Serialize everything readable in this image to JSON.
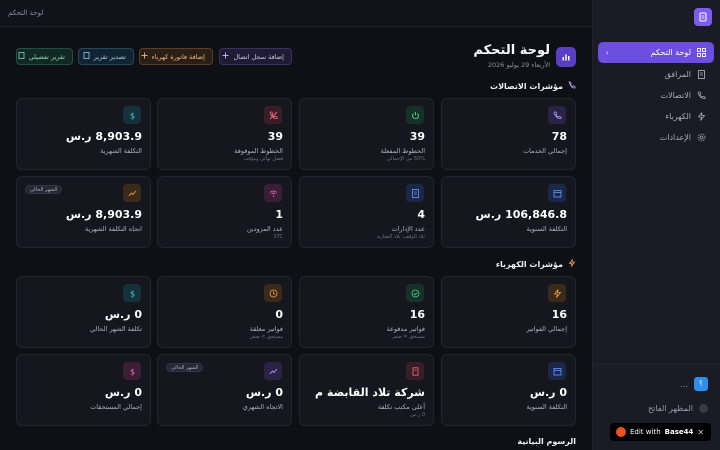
{
  "topbar": {
    "breadcrumb": "لوحة التحكم"
  },
  "header": {
    "title": "لوحة التحكم",
    "date": "الأربعاء 29 يوليو 2026"
  },
  "actions": {
    "add_call": "إضافة سجل اتصال",
    "add_invoice": "إضافة فاتورة كهرباء",
    "export_report": "تصدير تقرير",
    "detailed_report": "تقرير تفصيلي"
  },
  "sidebar": {
    "items": [
      {
        "label": "لوحة التحكم",
        "icon": "grid-icon",
        "active": true
      },
      {
        "label": "المرافق",
        "icon": "building-icon",
        "active": false
      },
      {
        "label": "الاتصالات",
        "icon": "phone-icon",
        "active": false
      },
      {
        "label": "الكهرباء",
        "icon": "bolt-icon",
        "active": false
      },
      {
        "label": "الإعدادات",
        "icon": "gear-icon",
        "active": false
      }
    ],
    "user": {
      "avatar_letter": "؟",
      "name": "..."
    },
    "theme_toggle": "المظهر الفاتح"
  },
  "sections": {
    "communications": "مؤشرات الاتصالات",
    "electricity": "مؤشرات الكهرباء",
    "charts": "الرسوم البيانية"
  },
  "comm_cards": [
    {
      "value": "78",
      "label": "إجمالي الخدمات",
      "sub": "",
      "icon": "phone-icon",
      "tone": "purple",
      "tag": ""
    },
    {
      "value": "39",
      "label": "الخطوط المفعلة",
      "sub": "50% من الإجمالي",
      "icon": "power-icon",
      "tone": "green",
      "tag": ""
    },
    {
      "value": "39",
      "label": "الخطوط الموقوفة",
      "sub": "فصل نهائي ومؤقت",
      "icon": "phone-off-icon",
      "tone": "red",
      "tag": ""
    },
    {
      "value": "8,903.9 ر.س",
      "label": "التكلفة الشهرية",
      "sub": "",
      "icon": "dollar-icon",
      "tone": "teal",
      "tag": ""
    },
    {
      "value": "106,846.8 ر.س",
      "label": "التكلفة السنوية",
      "sub": "",
      "icon": "calendar-icon",
      "tone": "blue",
      "tag": ""
    },
    {
      "value": "4",
      "label": "عدد الإدارات",
      "sub": "تلاد الوقف، تلاد العقارية",
      "icon": "building-icon",
      "tone": "blue",
      "tag": ""
    },
    {
      "value": "1",
      "label": "عدد المزودين",
      "sub": "STC",
      "icon": "wifi-icon",
      "tone": "pink",
      "tag": ""
    },
    {
      "value": "8,903.9 ر.س",
      "label": "اتجاه التكلفة الشهرية",
      "sub": "",
      "icon": "trend-icon",
      "tone": "orange",
      "tag": "الشهر الحالي"
    }
  ],
  "elec_cards": [
    {
      "value": "16",
      "label": "إجمالي الفواتير",
      "sub": "",
      "icon": "bolt-icon",
      "tone": "orange",
      "tag": ""
    },
    {
      "value": "16",
      "label": "فواتير مدفوعة",
      "sub": "مستحق = صفر",
      "icon": "check-icon",
      "tone": "green",
      "tag": ""
    },
    {
      "value": "0",
      "label": "فواتير معلقة",
      "sub": "مستحق > صفر",
      "icon": "clock-icon",
      "tone": "orange",
      "tag": ""
    },
    {
      "value": "0 ر.س",
      "label": "تكلفة الشهر الحالي",
      "sub": "",
      "icon": "dollar-icon",
      "tone": "teal",
      "tag": ""
    },
    {
      "value": "0 ر.س",
      "label": "التكلفة السنوية",
      "sub": "",
      "icon": "calendar-icon",
      "tone": "blue",
      "tag": ""
    },
    {
      "value": "شركة تلاد القابضة م",
      "label": "أعلى مكتب تكلفة",
      "sub": "0 ر.س",
      "icon": "receipt-icon",
      "tone": "red",
      "tag": ""
    },
    {
      "value": "0 ر.س",
      "label": "الاتجاه الشهري",
      "sub": "",
      "icon": "trend-icon",
      "tone": "purple",
      "tag": "الشهر الحالي"
    },
    {
      "value": "0 ر.س",
      "label": "إجمالي المستحقات",
      "sub": "",
      "icon": "dollar-icon",
      "tone": "pink",
      "tag": ""
    }
  ],
  "badge": {
    "text": "Edit with",
    "brand": "Base44"
  },
  "colors": {
    "accent": "#6d4ee0",
    "background": "#0f1016",
    "card": "#15161e"
  }
}
